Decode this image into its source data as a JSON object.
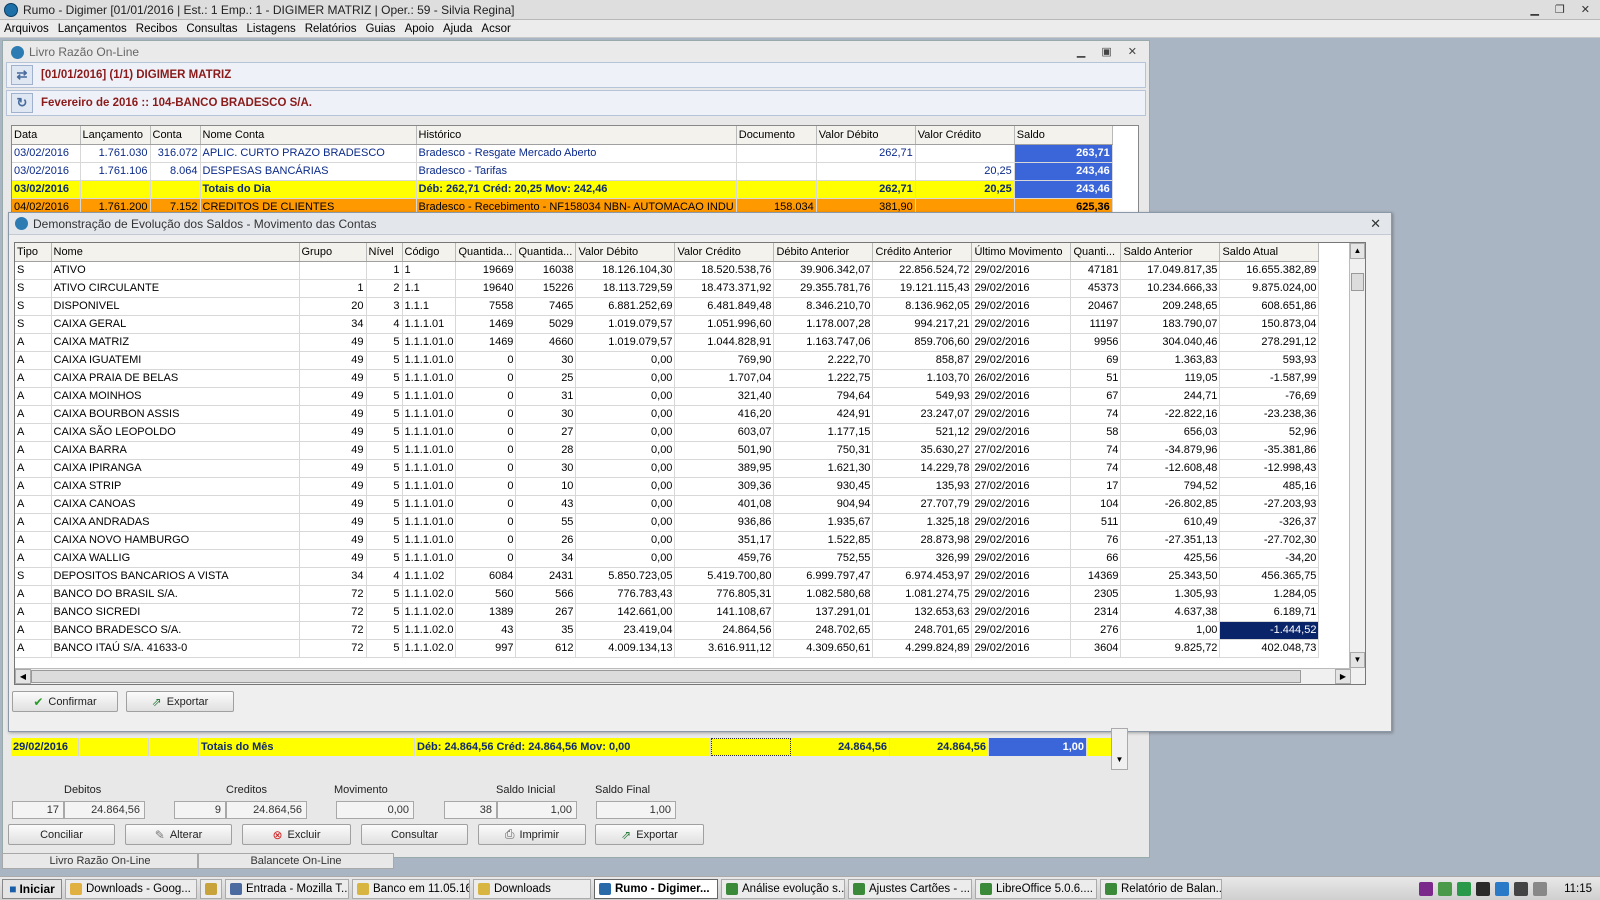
{
  "app": {
    "title": "Rumo - Digimer [01/01/2016 | Est.: 1 Emp.: 1 - DIGIMER MATRIZ | Oper.: 59 - Silvia Regina]",
    "menu": [
      "Arquivos",
      "Lançamentos",
      "Recibos",
      "Consultas",
      "Listagens",
      "Relatórios",
      "Guias",
      "Apoio",
      "Ajuda",
      "Acsor"
    ]
  },
  "livro": {
    "title": "Livro Razão On-Line",
    "header1": "[01/01/2016] (1/1) DIGIMER MATRIZ",
    "header2": "Fevereiro de 2016 :: 104-BANCO BRADESCO S/A.",
    "columns": [
      "Data",
      "Lançamento",
      "Conta",
      "Nome Conta",
      "Histórico",
      "Documento",
      "Valor Débito",
      "Valor Crédito",
      "Saldo"
    ],
    "rows": [
      [
        "03/02/2016",
        "1.761.030",
        "316.072",
        "APLIC. CURTO PRAZO BRADESCO",
        "Bradesco - Resgate Mercado Aberto",
        "",
        "262,71",
        "",
        "263,71"
      ],
      [
        "03/02/2016",
        "1.761.106",
        "8.064",
        "DESPESAS BANCÁRIAS",
        "Bradesco - Tarifas",
        "",
        "",
        "20,25",
        "243,46"
      ]
    ],
    "total_dia": [
      "03/02/2016",
      "",
      "",
      "Totais do Dia",
      "Déb: 262,71  Créd: 20,25  Mov: 242,46",
      "",
      "262,71",
      "20,25",
      "243,46"
    ],
    "orange_row": [
      "04/02/2016",
      "1.761.200",
      "7.152",
      "CREDITOS DE CLIENTES",
      "Bradesco - Recebimento - NF158034 NBN- AUTOMACAO INDU",
      "158.034",
      "381,90",
      "",
      "625,36"
    ],
    "total_mes": [
      "29/02/2016",
      "",
      "",
      "Totais do Mês",
      "Déb: 24.864,56   Créd: 24.864,56   Mov: 0,00",
      "",
      "24.864,56",
      "24.864,56",
      "1,00"
    ],
    "summary": {
      "debitos_label": "Debitos",
      "debitos_count": "17",
      "debitos_value": "24.864,56",
      "creditos_label": "Creditos",
      "creditos_count": "9",
      "creditos_value": "24.864,56",
      "movimento_label": "Movimento",
      "movimento_value": "0,00",
      "saldo_inicial_label": "Saldo Inicial",
      "saldo_inicial_count": "38",
      "saldo_inicial_value": "1,00",
      "saldo_final_label": "Saldo Final",
      "saldo_final_value": "1,00"
    },
    "buttons": {
      "conciliar": "Conciliar",
      "alterar": "Alterar",
      "excluir": "Excluir",
      "consultar": "Consultar",
      "imprimir": "Imprimir",
      "exportar": "Exportar"
    },
    "tabs": [
      "Livro Razão On-Line",
      "Balancete On-Line"
    ]
  },
  "demo": {
    "title": "Demonstração de Evolução dos Saldos - Movimento das Contas",
    "columns": [
      "Tipo",
      "Nome",
      "Grupo",
      "Nível",
      "Código",
      "Quantida...",
      "Quantida...",
      "Valor Débito",
      "Valor Crédito",
      "Débito Anterior",
      "Crédito Anterior",
      "Último Movimento",
      "Quanti...",
      "Saldo Anterior",
      "Saldo Atual"
    ],
    "rows": [
      [
        "S",
        "ATIVO",
        "",
        "1",
        "1",
        "19669",
        "16038",
        "18.126.104,30",
        "18.520.538,76",
        "39.906.342,07",
        "22.856.524,72",
        "29/02/2016",
        "47181",
        "17.049.817,35",
        "16.655.382,89"
      ],
      [
        "S",
        "ATIVO CIRCULANTE",
        "1",
        "2",
        "1.1",
        "19640",
        "15226",
        "18.113.729,59",
        "18.473.371,92",
        "29.355.781,76",
        "19.121.115,43",
        "29/02/2016",
        "45373",
        "10.234.666,33",
        "9.875.024,00"
      ],
      [
        "S",
        "DISPONIVEL",
        "20",
        "3",
        "1.1.1",
        "7558",
        "7465",
        "6.881.252,69",
        "6.481.849,48",
        "8.346.210,70",
        "8.136.962,05",
        "29/02/2016",
        "20467",
        "209.248,65",
        "608.651,86"
      ],
      [
        "S",
        "CAIXA GERAL",
        "34",
        "4",
        "1.1.1.01",
        "1469",
        "5029",
        "1.019.079,57",
        "1.051.996,60",
        "1.178.007,28",
        "994.217,21",
        "29/02/2016",
        "11197",
        "183.790,07",
        "150.873,04"
      ],
      [
        "A",
        "CAIXA MATRIZ",
        "49",
        "5",
        "1.1.1.01.0",
        "1469",
        "4660",
        "1.019.079,57",
        "1.044.828,91",
        "1.163.747,06",
        "859.706,60",
        "29/02/2016",
        "9956",
        "304.040,46",
        "278.291,12"
      ],
      [
        "A",
        "CAIXA IGUATEMI",
        "49",
        "5",
        "1.1.1.01.0",
        "0",
        "30",
        "0,00",
        "769,90",
        "2.222,70",
        "858,87",
        "29/02/2016",
        "69",
        "1.363,83",
        "593,93"
      ],
      [
        "A",
        "CAIXA PRAIA DE BELAS",
        "49",
        "5",
        "1.1.1.01.0",
        "0",
        "25",
        "0,00",
        "1.707,04",
        "1.222,75",
        "1.103,70",
        "26/02/2016",
        "51",
        "119,05",
        "-1.587,99"
      ],
      [
        "A",
        "CAIXA MOINHOS",
        "49",
        "5",
        "1.1.1.01.0",
        "0",
        "31",
        "0,00",
        "321,40",
        "794,64",
        "549,93",
        "29/02/2016",
        "67",
        "244,71",
        "-76,69"
      ],
      [
        "A",
        "CAIXA BOURBON ASSIS",
        "49",
        "5",
        "1.1.1.01.0",
        "0",
        "30",
        "0,00",
        "416,20",
        "424,91",
        "23.247,07",
        "29/02/2016",
        "74",
        "-22.822,16",
        "-23.238,36"
      ],
      [
        "A",
        "CAIXA SÃO LEOPOLDO",
        "49",
        "5",
        "1.1.1.01.0",
        "0",
        "27",
        "0,00",
        "603,07",
        "1.177,15",
        "521,12",
        "29/02/2016",
        "58",
        "656,03",
        "52,96"
      ],
      [
        "A",
        "CAIXA BARRA",
        "49",
        "5",
        "1.1.1.01.0",
        "0",
        "28",
        "0,00",
        "501,90",
        "750,31",
        "35.630,27",
        "27/02/2016",
        "74",
        "-34.879,96",
        "-35.381,86"
      ],
      [
        "A",
        "CAIXA IPIRANGA",
        "49",
        "5",
        "1.1.1.01.0",
        "0",
        "30",
        "0,00",
        "389,95",
        "1.621,30",
        "14.229,78",
        "29/02/2016",
        "74",
        "-12.608,48",
        "-12.998,43"
      ],
      [
        "A",
        "CAIXA STRIP",
        "49",
        "5",
        "1.1.1.01.0",
        "0",
        "10",
        "0,00",
        "309,36",
        "930,45",
        "135,93",
        "27/02/2016",
        "17",
        "794,52",
        "485,16"
      ],
      [
        "A",
        "CAIXA CANOAS",
        "49",
        "5",
        "1.1.1.01.0",
        "0",
        "43",
        "0,00",
        "401,08",
        "904,94",
        "27.707,79",
        "29/02/2016",
        "104",
        "-26.802,85",
        "-27.203,93"
      ],
      [
        "A",
        "CAIXA ANDRADAS",
        "49",
        "5",
        "1.1.1.01.0",
        "0",
        "55",
        "0,00",
        "936,86",
        "1.935,67",
        "1.325,18",
        "29/02/2016",
        "511",
        "610,49",
        "-326,37"
      ],
      [
        "A",
        "CAIXA NOVO HAMBURGO",
        "49",
        "5",
        "1.1.1.01.0",
        "0",
        "26",
        "0,00",
        "351,17",
        "1.522,85",
        "28.873,98",
        "29/02/2016",
        "76",
        "-27.351,13",
        "-27.702,30"
      ],
      [
        "A",
        "CAIXA WALLIG",
        "49",
        "5",
        "1.1.1.01.0",
        "0",
        "34",
        "0,00",
        "459,76",
        "752,55",
        "326,99",
        "29/02/2016",
        "66",
        "425,56",
        "-34,20"
      ],
      [
        "S",
        "DEPOSITOS BANCARIOS A VISTA",
        "34",
        "4",
        "1.1.1.02",
        "6084",
        "2431",
        "5.850.723,05",
        "5.419.700,80",
        "6.999.797,47",
        "6.974.453,97",
        "29/02/2016",
        "14369",
        "25.343,50",
        "456.365,75"
      ],
      [
        "A",
        "BANCO DO BRASIL S/A.",
        "72",
        "5",
        "1.1.1.02.0",
        "560",
        "566",
        "776.783,43",
        "776.805,31",
        "1.082.580,68",
        "1.081.274,75",
        "29/02/2016",
        "2305",
        "1.305,93",
        "1.284,05"
      ],
      [
        "A",
        "BANCO SICREDI",
        "72",
        "5",
        "1.1.1.02.0",
        "1389",
        "267",
        "142.661,00",
        "141.108,67",
        "137.291,01",
        "132.653,63",
        "29/02/2016",
        "2314",
        "4.637,38",
        "6.189,71"
      ],
      [
        "A",
        "BANCO BRADESCO S/A.",
        "72",
        "5",
        "1.1.1.02.0",
        "43",
        "35",
        "23.419,04",
        "24.864,56",
        "248.702,65",
        "248.701,65",
        "29/02/2016",
        "276",
        "1,00",
        "-1.444,52"
      ],
      [
        "A",
        "BANCO ITAÚ S/A. 41633-0",
        "72",
        "5",
        "1.1.1.02.0",
        "997",
        "612",
        "4.009.134,13",
        "3.616.911,12",
        "4.309.650,61",
        "4.299.824,89",
        "29/02/2016",
        "3604",
        "9.825,72",
        "402.048,73"
      ]
    ],
    "buttons": {
      "confirmar": "Confirmar",
      "exportar": "Exportar"
    }
  },
  "taskbar": {
    "start": "Iniciar",
    "items": [
      "Downloads - Goog...",
      "Entrada - Mozilla T...",
      "Banco em 11.05.16",
      "Downloads",
      "Rumo - Digimer...",
      "Análise evolução s...",
      "Ajustes Cartões - ...",
      "LibreOffice 5.0.6....",
      "Relatório de Balan..."
    ],
    "clock": "11:15"
  }
}
